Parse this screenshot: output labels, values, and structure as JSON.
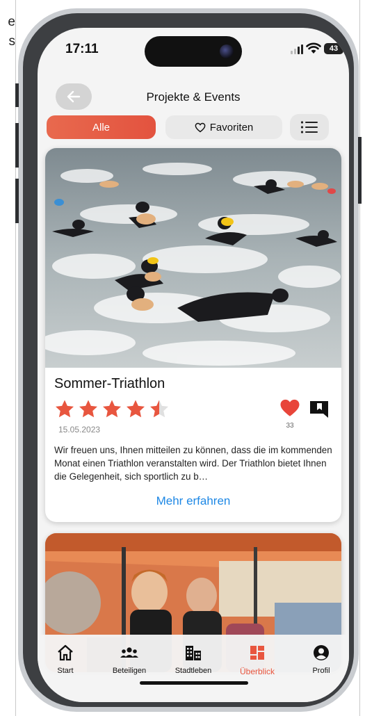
{
  "left_snippet": [
    "e",
    "s"
  ],
  "status_bar": {
    "time": "17:11",
    "battery": "43"
  },
  "header": {
    "title": "Projekte & Events"
  },
  "filters": {
    "all_label": "Alle",
    "favorites_label": "Favoriten"
  },
  "event": {
    "title": "Sommer-Triathlon",
    "rating": 4.5,
    "rating_max": 5,
    "date": "15.05.2023",
    "likes": "33",
    "description": "Wir freuen uns, Ihnen mitteilen zu können, dass die im kommenden Monat einen Triathlon veranstalten wird. Der Triathlon bietet Ihnen die Gelegenheit, sich sportlich zu b…",
    "more_label": "Mehr erfahren"
  },
  "tabbar": {
    "items": [
      {
        "label": "Start",
        "icon": "house-icon"
      },
      {
        "label": "Beteiligen",
        "icon": "people-icon"
      },
      {
        "label": "Stadtleben",
        "icon": "buildings-icon"
      },
      {
        "label": "Überblick",
        "icon": "dashboard-icon",
        "active": true
      },
      {
        "label": "Profil",
        "icon": "user-circle-icon"
      }
    ]
  },
  "colors": {
    "accent": "#e8563f",
    "link": "#1e88e5",
    "star_empty": "#e0e0e0"
  }
}
